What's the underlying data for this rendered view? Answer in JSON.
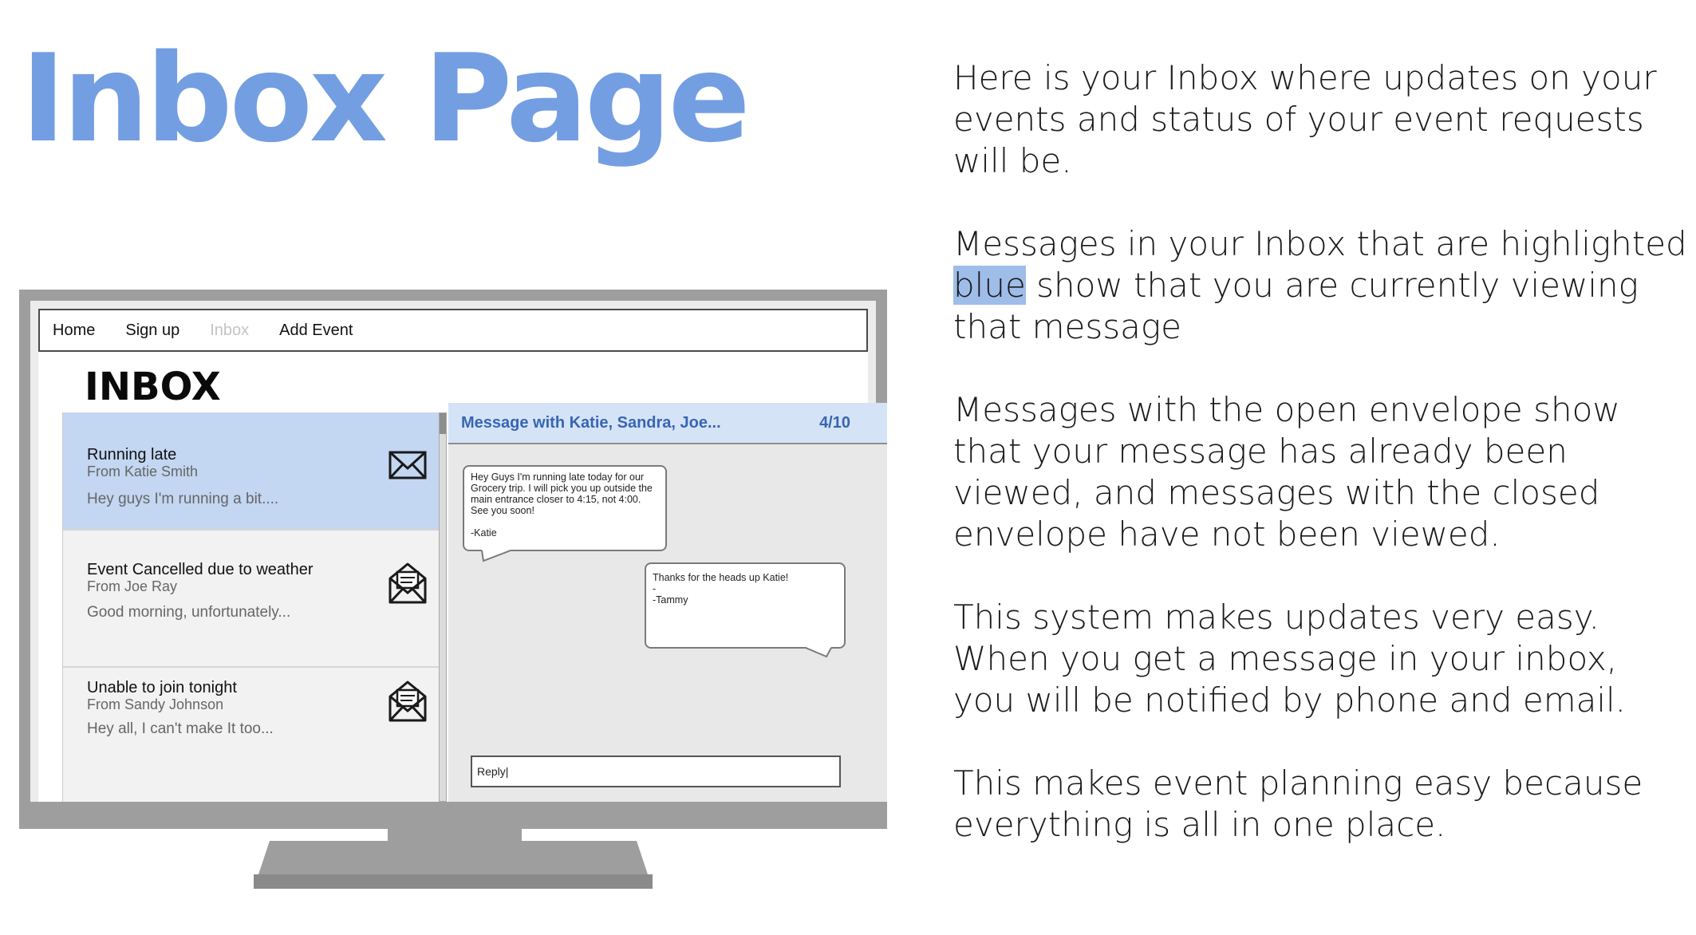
{
  "slide": {
    "title": "Inbox Page",
    "paragraphs": {
      "p1": "Here is your Inbox where updates on your events and status of your event requests will be.",
      "p2_before": "Messages in your Inbox that are highlighted ",
      "p2_highlight": "blue",
      "p2_after": " show that you are currently viewing that message",
      "p3": "Messages with the open envelope show that your message has already been viewed, and messages with the closed envelope have not been viewed.",
      "p4": "This system makes updates very easy. When you get a message in your inbox, you will be notified by phone and email.",
      "p5": "This makes event planning easy because everything is all in one place."
    },
    "highlight_color": "#9fbde9",
    "title_color": "#739ee2"
  },
  "app": {
    "nav": {
      "home": "Home",
      "signup": "Sign up",
      "inbox": "Inbox",
      "add_event": "Add Event",
      "active": "Inbox"
    },
    "heading": "INBOX",
    "messages": [
      {
        "subject": "Running late",
        "from": "From Katie Smith",
        "preview": "Hey guys I'm running a bit....",
        "icon": "closed-envelope-icon",
        "selected": true
      },
      {
        "subject": "Event Cancelled due to weather",
        "from": "From Joe Ray",
        "preview": "Good morning, unfortunately...",
        "icon": "open-envelope-icon",
        "selected": false
      },
      {
        "subject": "Unable to join tonight",
        "from": "From Sandy Johnson",
        "preview": "Hey all, I can't make It too...",
        "icon": "open-envelope-icon",
        "selected": false
      }
    ],
    "conversation": {
      "title": "Message with Katie, Sandra, Joe...",
      "count": "4/10",
      "incoming": "Hey Guys I'm running late today for our Grocery trip. I will pick you up outside the main entrance closer to 4:15, not 4:00. See you soon!\n\n-Katie",
      "outgoing": "Thanks for the heads up Katie!\n-\n-Tammy",
      "reply_value": "Reply|"
    },
    "selected_color": "#c3d6f2",
    "header_color": "#d5e3f6",
    "accent_text_color": "#3766b3"
  }
}
